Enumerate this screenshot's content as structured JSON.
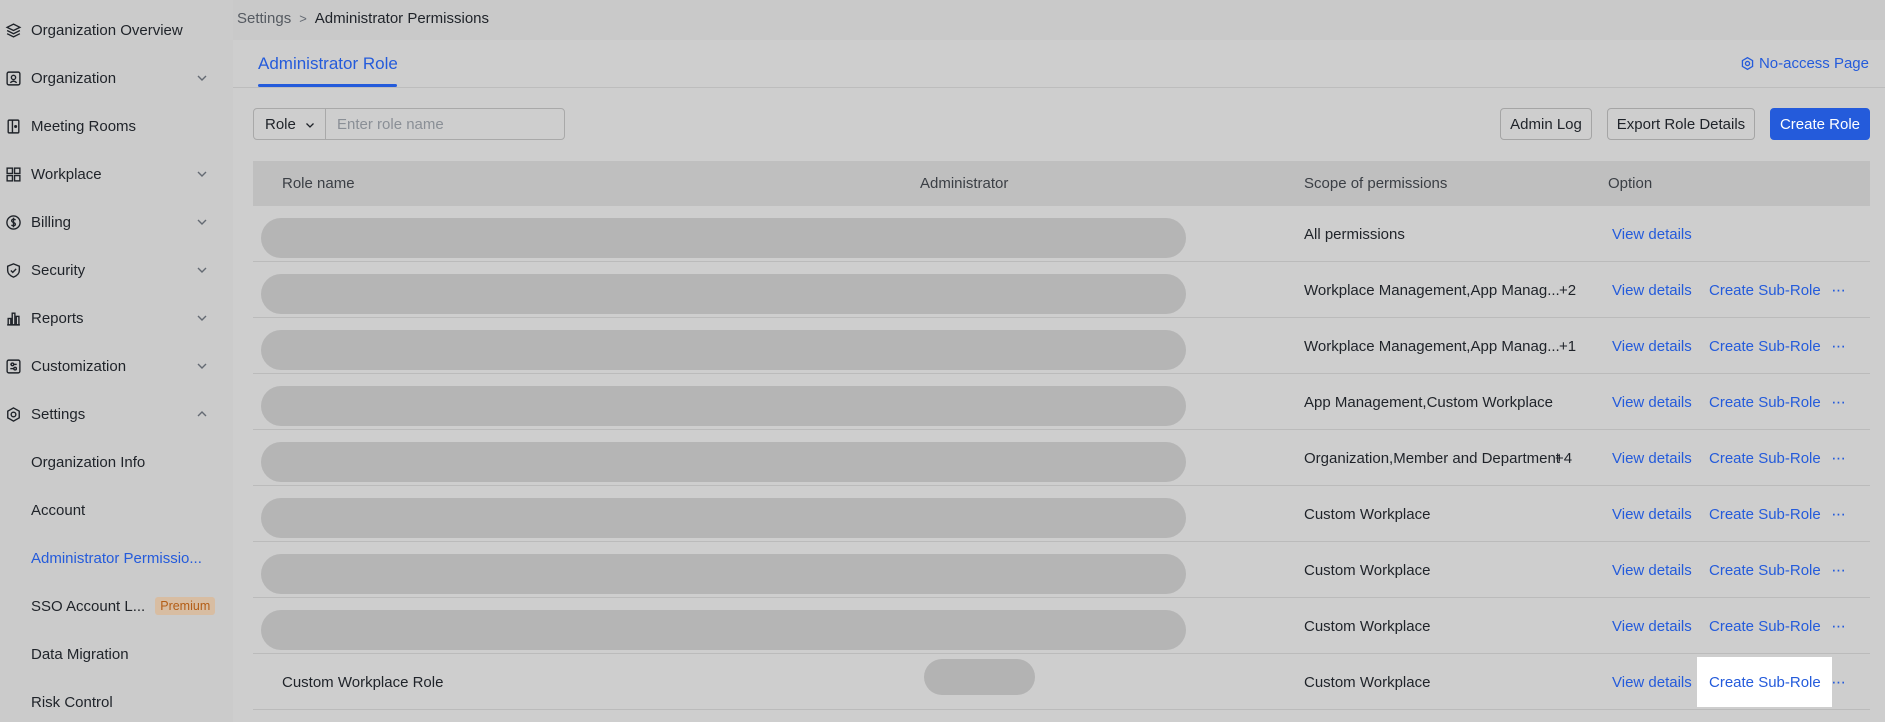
{
  "sidebar": {
    "items": [
      {
        "label": "Organization Overview",
        "icon": "layers-icon"
      },
      {
        "label": "Organization",
        "icon": "org-card-icon"
      },
      {
        "label": "Meeting Rooms",
        "icon": "meeting-room-icon"
      },
      {
        "label": "Workplace",
        "icon": "grid-icon"
      },
      {
        "label": "Billing",
        "icon": "dollar-icon"
      },
      {
        "label": "Security",
        "icon": "shield-icon"
      },
      {
        "label": "Reports",
        "icon": "bar-chart-icon"
      },
      {
        "label": "Customization",
        "icon": "customize-icon"
      },
      {
        "label": "Settings",
        "icon": "gear-icon"
      }
    ],
    "sub_items": [
      {
        "label": "Organization Info"
      },
      {
        "label": "Account"
      },
      {
        "label": "Administrator Permissio..."
      },
      {
        "label": "SSO Account L...",
        "badge": "Premium"
      },
      {
        "label": "Data Migration"
      },
      {
        "label": "Risk Control"
      }
    ]
  },
  "breadcrumb": {
    "parent": "Settings",
    "separator": ">",
    "current": "Administrator Permissions"
  },
  "tabs": {
    "active": "Administrator Role"
  },
  "header": {
    "no_access": "No-access Page"
  },
  "toolbar": {
    "role_select": "Role",
    "search_placeholder": "Enter role name",
    "admin_log": "Admin Log",
    "export": "Export Role Details",
    "create": "Create Role"
  },
  "table": {
    "columns": [
      "Role name",
      "Administrator",
      "Scope of permissions",
      "Option"
    ],
    "rows": [
      {
        "scope": "All permissions",
        "count": "",
        "view": "View details"
      },
      {
        "scope": "Workplace Management,App Manag...",
        "count": "+2",
        "view": "View details",
        "sub": "Create Sub-Role",
        "more": "···"
      },
      {
        "scope": "Workplace Management,App Manag...",
        "count": "+1",
        "view": "View details",
        "sub": "Create Sub-Role",
        "more": "···"
      },
      {
        "scope": "App Management,Custom Workplace",
        "count": "",
        "view": "View details",
        "sub": "Create Sub-Role",
        "more": "···"
      },
      {
        "scope": "Organization,Member and Department",
        "count": "+4",
        "view": "View details",
        "sub": "Create Sub-Role",
        "more": "···"
      },
      {
        "scope": "Custom Workplace",
        "count": "",
        "view": "View details",
        "sub": "Create Sub-Role",
        "more": "···"
      },
      {
        "scope": "Custom Workplace",
        "count": "",
        "view": "View details",
        "sub": "Create Sub-Role",
        "more": "···"
      },
      {
        "scope": "Custom Workplace",
        "count": "",
        "view": "View details",
        "sub": "Create Sub-Role",
        "more": "···"
      },
      {
        "name": "Custom Workplace Role",
        "scope": "Custom Workplace",
        "count": "",
        "view": "View details",
        "sub": "Create Sub-Role",
        "more": "···"
      }
    ]
  },
  "colors": {
    "accent": "#245bdb",
    "premium": "#b35d15"
  }
}
